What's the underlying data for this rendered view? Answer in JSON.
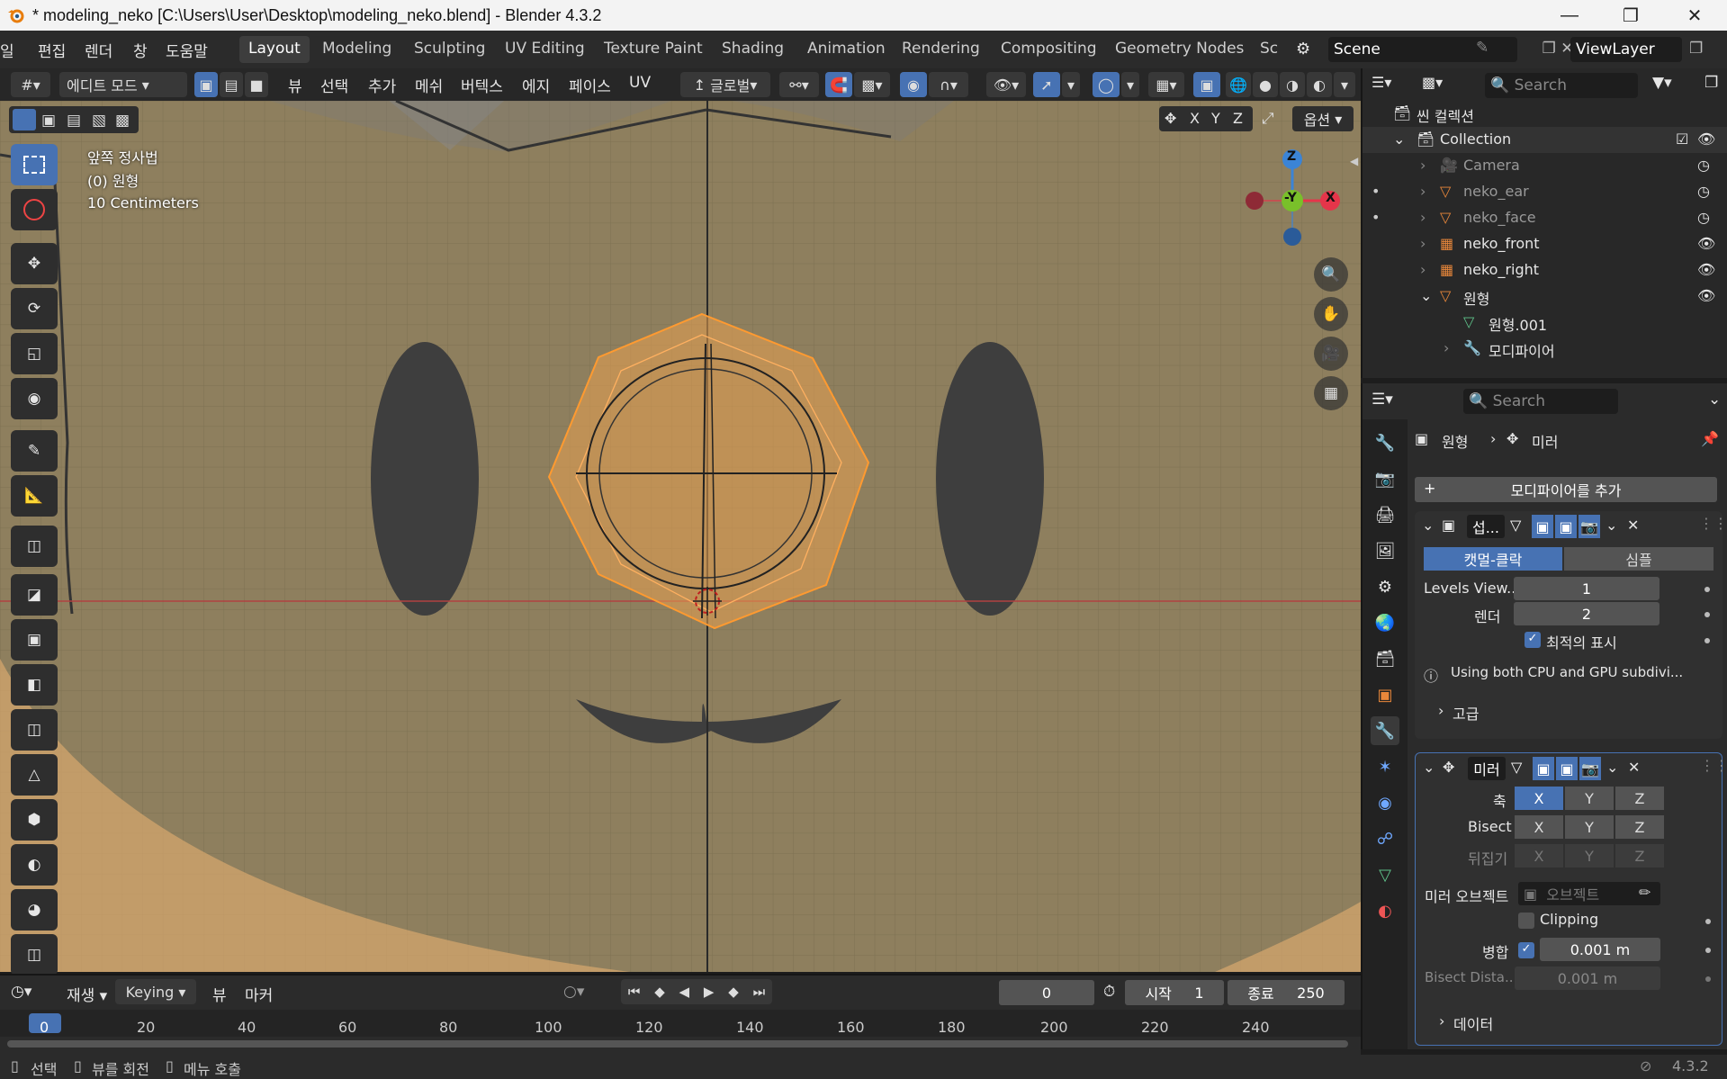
{
  "window": {
    "title": "* modeling_neko [C:\\Users\\User\\Desktop\\modeling_neko.blend] - Blender 4.3.2"
  },
  "menus": [
    "일",
    "편집",
    "렌더",
    "창",
    "도움말"
  ],
  "workspaces": [
    "Layout",
    "Modeling",
    "Sculpting",
    "UV Editing",
    "Texture Paint",
    "Shading",
    "Animation",
    "Rendering",
    "Compositing",
    "Geometry Nodes",
    "Sc"
  ],
  "scene": "Scene",
  "view_layer": "ViewLayer",
  "viewport_header": {
    "mode": "에디트 모드",
    "menus": [
      "뷰",
      "선택",
      "추가",
      "메쉬",
      "버텍스",
      "에지",
      "페이스",
      "UV"
    ],
    "transform": "글로벌",
    "axes": [
      "X",
      "Y",
      "Z"
    ],
    "options": "옵션"
  },
  "viewport_info": {
    "view": "앞쪽 정사법",
    "object": "(0) 원형",
    "scale": "10 Centimeters"
  },
  "gizmo": {
    "z": "Z",
    "y": "-Y",
    "x": "X"
  },
  "outliner": {
    "search_placeholder": "Search",
    "root": "씬 컬렉션",
    "collection": "Collection",
    "items": [
      "Camera",
      "neko_ear",
      "neko_face",
      "neko_front",
      "neko_right",
      "원형",
      "원형.001",
      "모디파이어"
    ]
  },
  "properties": {
    "search_placeholder": "Search",
    "breadcrumb": {
      "object": "원형",
      "modifier": "미러"
    },
    "add_modifier": "모디파이어를 추가",
    "subsurf": {
      "name": "섭...",
      "tabs": [
        "캣멀-클락",
        "심플"
      ],
      "levels_label": "Levels View...",
      "levels_value": "1",
      "render_label": "렌더",
      "render_value": "2",
      "optimal": "최적의 표시",
      "info": "Using both CPU and GPU subdivi...",
      "advanced": "고급"
    },
    "mirror": {
      "name": "미러",
      "axis_label": "축",
      "bisect_label": "Bisect",
      "flip_label": "뒤집기",
      "axes": [
        "X",
        "Y",
        "Z"
      ],
      "mirror_object_label": "미러 오브젝트",
      "mirror_object_placeholder": "오브젝트",
      "clipping": "Clipping",
      "merge_label": "병합",
      "merge_value": "0.001 m",
      "bisect_dist_label": "Bisect Dista...",
      "bisect_dist_value": "0.001 m",
      "data": "데이터"
    }
  },
  "timeline": {
    "menus": [
      "재생",
      "Keying",
      "뷰",
      "마커"
    ],
    "current_frame": "0",
    "start_label": "시작",
    "start": "1",
    "end_label": "종료",
    "end": "250",
    "ruler": [
      "0",
      "20",
      "40",
      "60",
      "80",
      "100",
      "120",
      "140",
      "160",
      "180",
      "200",
      "220",
      "240"
    ]
  },
  "status": {
    "select": "선택",
    "rotate": "뷰를 회전",
    "menu": "메뉴 호출",
    "version": "4.3.2"
  }
}
